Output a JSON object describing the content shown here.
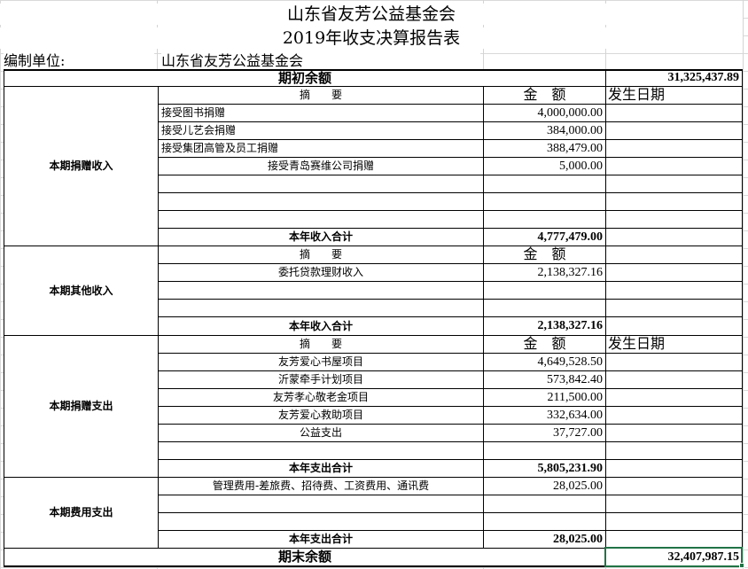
{
  "title_line1": "山东省友芳公益基金会",
  "title_line2": "2019年收支决算报告表",
  "unit_label": "编制单位:",
  "unit_value": "山东省友芳公益基金会",
  "opening_label": "期初余额",
  "opening_value": "31,325,437.89",
  "col_summary": "摘　　要",
  "col_amount": "金　额",
  "col_date": "发生日期",
  "donation_income": {
    "label": "本期捐赠收入",
    "items": [
      {
        "desc": "接受图书捐赠",
        "amount": "4,000,000.00"
      },
      {
        "desc": "接受儿艺会捐赠",
        "amount": "384,000.00"
      },
      {
        "desc": "接受集团高管及员工捐赠",
        "amount": "388,479.00"
      },
      {
        "desc": "接受青岛赛维公司捐赠",
        "amount": "5,000.00"
      }
    ],
    "total_label": "本年收入合计",
    "total_value": "4,777,479.00"
  },
  "other_income": {
    "label": "本期其他收入",
    "items": [
      {
        "desc": "委托贷款理财收入",
        "amount": "2,138,327.16"
      }
    ],
    "total_label": "本年收入合计",
    "total_value": "2,138,327.16"
  },
  "donation_expense": {
    "label": "本期捐赠支出",
    "items": [
      {
        "desc": "友芳爱心书屋项目",
        "amount": "4,649,528.50"
      },
      {
        "desc": "沂蒙牵手计划项目",
        "amount": "573,842.40"
      },
      {
        "desc": "友芳孝心敬老金项目",
        "amount": "211,500.00"
      },
      {
        "desc": "友芳爱心救助项目",
        "amount": "332,634.00"
      },
      {
        "desc": "公益支出",
        "amount": "37,727.00"
      }
    ],
    "total_label": "本年支出合计",
    "total_value": "5,805,231.90"
  },
  "fee_expense": {
    "label": "本期费用支出",
    "items": [
      {
        "desc": "管理费用-差旅费、招待费、工资费用、通讯费",
        "amount": "28,025.00"
      }
    ],
    "total_label": "本年支出合计",
    "total_value": "28,025.00"
  },
  "closing_label": "期末余额",
  "closing_value": "32,407,987.15",
  "colors": {
    "selection": "#217346",
    "gridline": "#d9d9d9",
    "border": "#000000"
  }
}
